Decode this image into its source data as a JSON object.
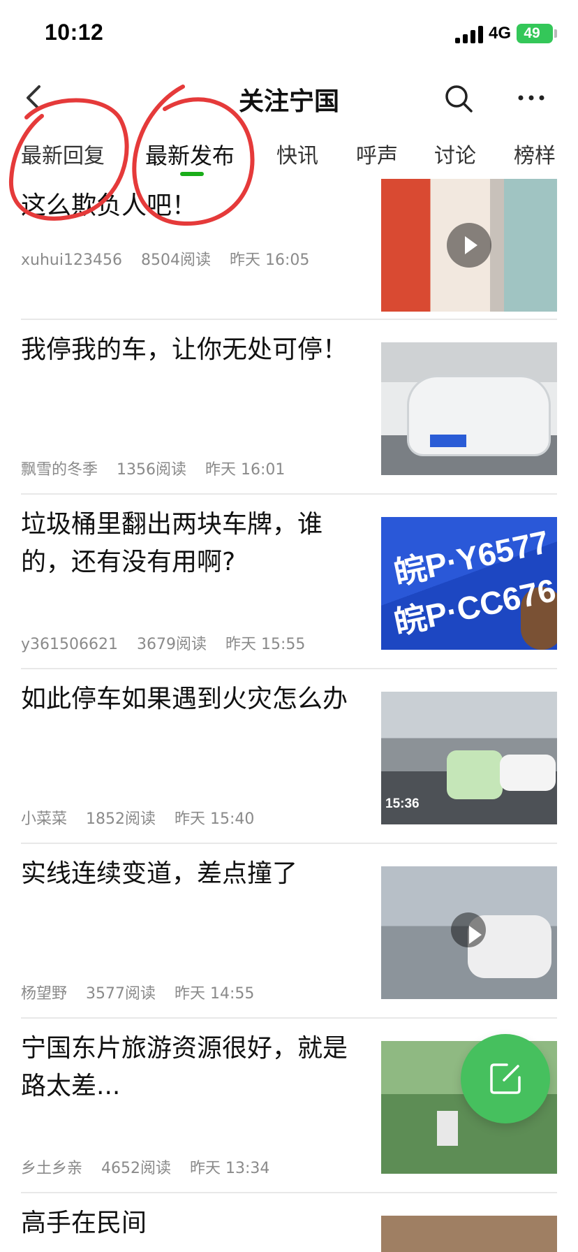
{
  "status_bar": {
    "time": "10:12",
    "network": "4G",
    "battery": "49"
  },
  "nav": {
    "title": "关注宁国"
  },
  "tabs": [
    "最新回复",
    "最新发布",
    "快讯",
    "呼声",
    "讨论",
    "榜样"
  ],
  "active_tab": "最新发布",
  "posts": [
    {
      "title": "虽然顾客是上帝，但是也不能这么欺负人吧！",
      "author": "xuhui123456",
      "reads": "8504阅读",
      "time": "昨天 16:05",
      "video": true
    },
    {
      "title": "我停我的车，让你无处可停！",
      "author": "飘雪的冬季",
      "reads": "1356阅读",
      "time": "昨天 16:01",
      "video": false
    },
    {
      "title": "垃圾桶里翻出两块车牌，谁的，还有没有用啊?",
      "author": "y361506621",
      "reads": "3679阅读",
      "time": "昨天 15:55",
      "video": false
    },
    {
      "title": "如此停车如果遇到火灾怎么办",
      "author": "小菜菜",
      "reads": "1852阅读",
      "time": "昨天 15:40",
      "video": false
    },
    {
      "title": "实线连续变道，差点撞了",
      "author": "杨望野",
      "reads": "3577阅读",
      "time": "昨天 14:55",
      "video": true
    },
    {
      "title": "宁国东片旅游资源很好，就是路太差...",
      "author": "乡土乡亲",
      "reads": "4652阅读",
      "time": "昨天 13:34",
      "video": false
    },
    {
      "title": "高手在民间"
    }
  ],
  "thumb_text": {
    "plate_1": "皖P·Y6577",
    "plate_2": "皖P·CC676",
    "camera_time": "15:36"
  },
  "colors": {
    "accent": "#1aad19",
    "fab": "#46c05e",
    "annotation": "#e53a3a",
    "battery": "#34c759"
  },
  "icons": [
    "back-icon",
    "search-icon",
    "more-icon",
    "play-icon",
    "compose-icon"
  ]
}
